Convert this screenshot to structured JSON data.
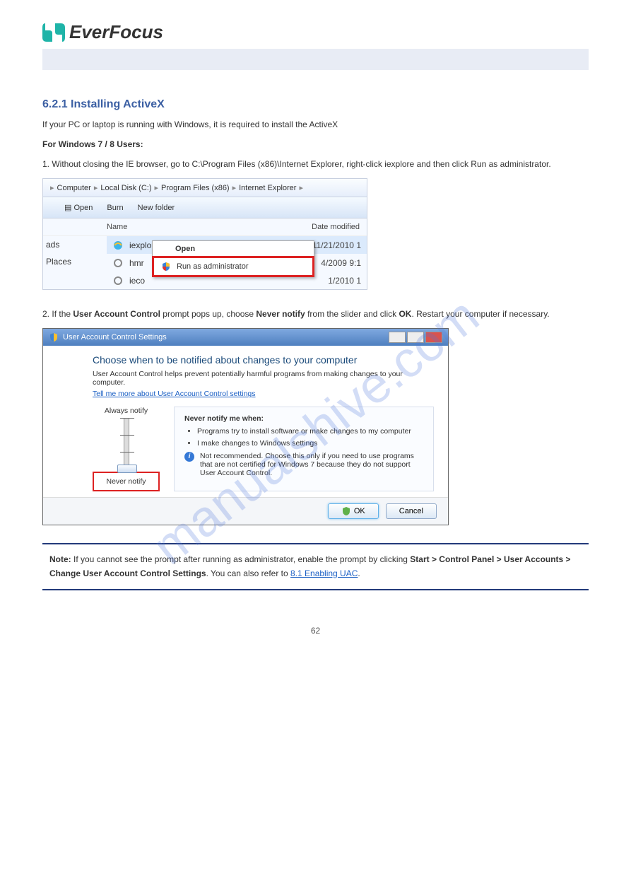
{
  "logo": {
    "brand": "EverFocus"
  },
  "header_bar": "",
  "section1": {
    "title": "6.2.1 Installing ActiveX",
    "para1": "If your PC or laptop is running with Windows, it is required to install the ActiveX"
  },
  "win7": {
    "heading": "For Windows 7 / 8 Users:",
    "step1_prefix": "1.",
    "step1": "Without closing the IE browser, go to C:\\Program Files (x86)\\Internet Explorer, right-click iexplore and then click Run as administrator.",
    "explorer": {
      "breadcrumb": [
        "Computer",
        "Local Disk (C:)",
        "Program Files (x86)",
        "Internet Explorer"
      ],
      "toolbar": {
        "open": "Open",
        "burn": "Burn",
        "newfolder": "New folder"
      },
      "headers": {
        "name": "Name",
        "date": "Date modified"
      },
      "sidebar": [
        "ads",
        "Places"
      ],
      "files": [
        {
          "name": "iexplore",
          "date": "11/21/2010 1"
        },
        {
          "name": "hmr",
          "date": "4/2009 9:1"
        },
        {
          "name": "ieco",
          "date": "1/2010 1"
        }
      ],
      "context": {
        "open": "Open",
        "runas": "Run as administrator"
      }
    },
    "step2_prefix": "2.",
    "step2_a": "If the ",
    "step2_b": "User Account Control",
    "step2_c": " prompt pops up, choose ",
    "step2_d": "Never notify",
    "step2_e": " from the slider and click ",
    "step2_f": "OK",
    "step2_g": ". Restart your computer if necessary."
  },
  "uac": {
    "title": "User Account Control Settings",
    "heading": "Choose when to be notified about changes to your computer",
    "desc": "User Account Control helps prevent potentially harmful programs from making changes to your computer.",
    "link": "Tell me more about User Account Control settings",
    "always": "Always notify",
    "never": "Never notify",
    "panel_title": "Never notify me when:",
    "bullet1": "Programs try to install software or make changes to my computer",
    "bullet2": "I make changes to Windows settings",
    "info": "Not recommended. Choose this only if you need to use programs that are not certified for Windows 7 because they do not support User Account Control.",
    "ok": "OK",
    "cancel": "Cancel"
  },
  "note": {
    "label": "Note:",
    "text_a": " If you cannot see the prompt after running as administrator, enable the prompt by clicking ",
    "b1": "Start > Control Panel > User Accounts > Change User Account Control Settings",
    "text_b": ". You can also refer to ",
    "link": "8.1 Enabling UAC",
    "text_c": "."
  },
  "page_number": "62",
  "watermark": "manualshive.com"
}
